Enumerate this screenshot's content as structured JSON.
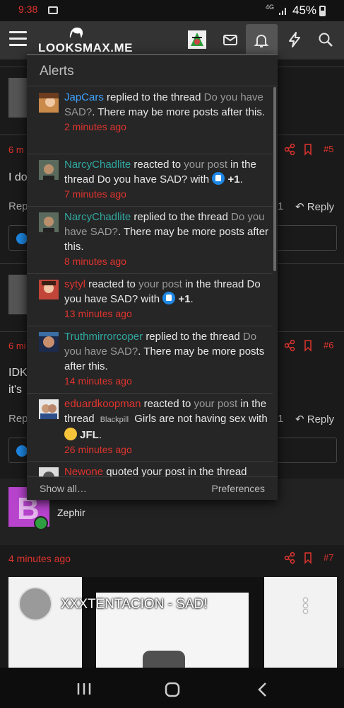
{
  "statusbar": {
    "time": "9:38",
    "network": "4G",
    "battery": "45%"
  },
  "nav": {
    "logo": "LOOKSMAX.ME"
  },
  "background": {
    "post_a_time": "6 m",
    "post_a_text": "I do",
    "reply_label": "Reply",
    "rep_left": "Rep",
    "count_1": "1",
    "post_b_time": "6 mi",
    "post_b_text_1": "IDK",
    "post_b_text_2": "it's",
    "post_a_num": "#5",
    "post_b_num": "#6"
  },
  "post": {
    "username": "Zephir",
    "time": "4 minutes ago",
    "number": "#7",
    "video_title": "XXXTENTACION - SAD!"
  },
  "alerts": {
    "title": "Alerts",
    "show_all": "Show all…",
    "preferences": "Preferences",
    "items": [
      {
        "user": "JapCars",
        "action": "replied to the thread",
        "thread": "Do you have SAD?",
        "tail": ". There may be more posts after this.",
        "time": "2 minutes ago"
      },
      {
        "user": "NarcyChadlite",
        "action": "reacted to",
        "link": "your post",
        "rest": "in the thread Do you have SAD? with",
        "reaction": "+1",
        "time": "7 minutes ago"
      },
      {
        "user": "NarcyChadlite",
        "action": "replied to the thread",
        "thread": "Do you have SAD?",
        "tail": ". There may be more posts after this.",
        "time": "8 minutes ago"
      },
      {
        "user": "sytyl",
        "action": "reacted to",
        "link": "your post",
        "rest": "in the thread Do you have SAD? with",
        "reaction": "+1",
        "time": "13 minutes ago"
      },
      {
        "user": "Truthmirrorcoper",
        "action": "replied to the thread",
        "thread": "Do you have SAD?",
        "tail": ". There may be more posts after this.",
        "time": "14 minutes ago"
      },
      {
        "user": "eduardkoopman",
        "action": "reacted to",
        "link": "your post",
        "rest_1": "in the thread",
        "prefix": "Blackpill",
        "rest_2": "Girls are not having sex with",
        "reaction": "JFL",
        "time": "26 minutes ago"
      },
      {
        "user": "Newone",
        "action": "quoted your post in the thread"
      }
    ]
  },
  "colors": {
    "accent_red": "#e0342e",
    "user_teal": "#2fa8a0",
    "user_blue": "#3ea1ff"
  }
}
